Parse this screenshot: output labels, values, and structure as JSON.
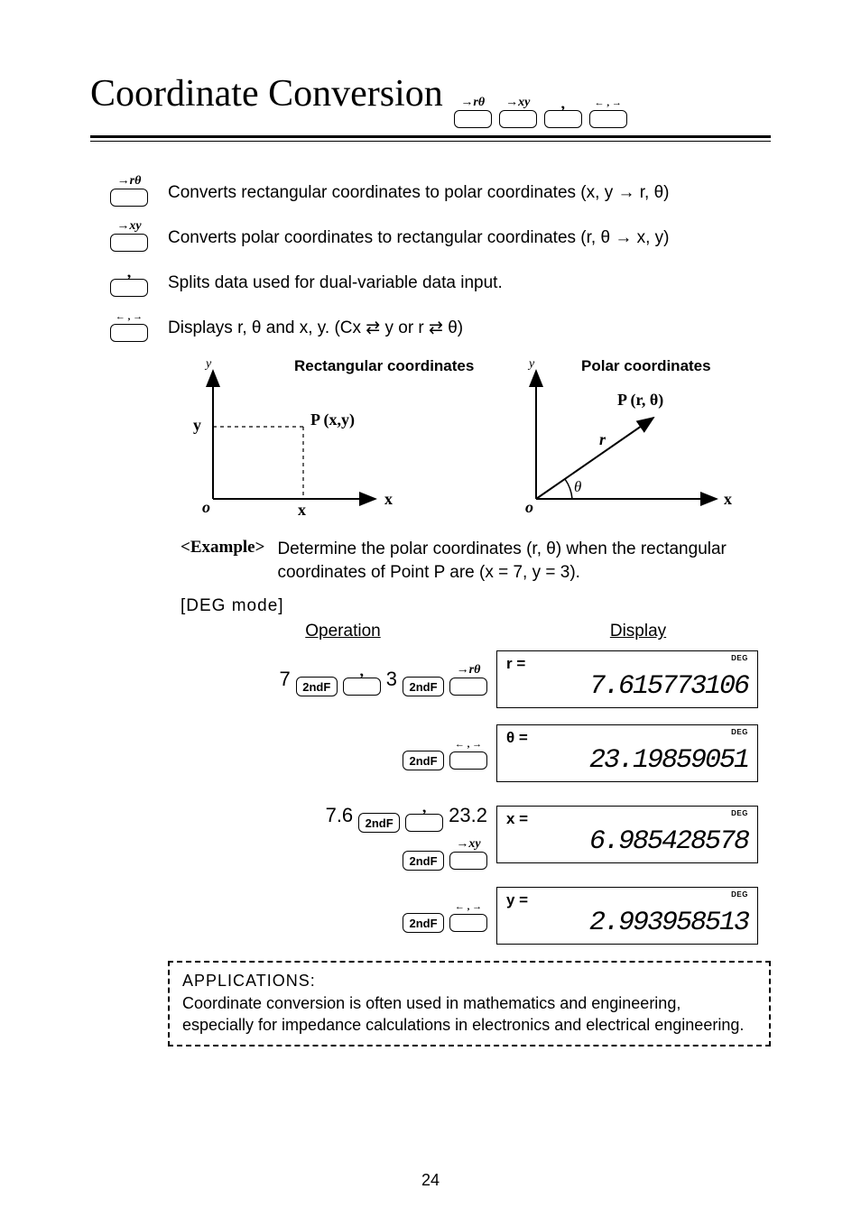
{
  "title": "Coordinate Conversion",
  "titleKeys": [
    "→rθ",
    "→xy",
    ",",
    "← , →"
  ],
  "defs": [
    {
      "keyTop": "→rθ",
      "desc": "Converts rectangular coordinates to polar coordinates (x, y → r, θ)"
    },
    {
      "keyTop": "→xy",
      "desc": "Converts polar coordinates to rectangular coordinates (r, θ → x, y)"
    },
    {
      "keyTop": ",",
      "desc": "Splits data used for dual-variable data input."
    },
    {
      "keyTop": "← , →",
      "desc": "Displays r, θ and x, y. (Cx ⇄ y or r ⇄ θ)"
    }
  ],
  "diagrams": {
    "rect": {
      "title": "Rectangular coordinates",
      "point": "P (x,y)",
      "o": "o",
      "x": "x",
      "y": "y",
      "X": "x",
      "Y": "y"
    },
    "polar": {
      "title": "Polar coordinates",
      "point": "P (r, θ)",
      "o": "o",
      "X": "x",
      "r": "r",
      "theta": "θ",
      "yAxis": "y"
    }
  },
  "example": {
    "tag": "<Example>",
    "text": "Determine the polar coordinates (r, θ) when the rectangular coordinates of Point P are (x = 7, y = 3).",
    "mode": "[DEG mode]",
    "headers": {
      "op": "Operation",
      "disp": "Display"
    }
  },
  "keys": {
    "secondF": "2ndF"
  },
  "steps": [
    {
      "opBefore": "7",
      "seq": [
        "2ndF",
        ",",
        "opMid:3",
        "2ndF",
        "→rθ"
      ],
      "lcdSym": "r =",
      "lcdVal": "7.615773106",
      "lcdMode": "DEG"
    },
    {
      "seq": [
        "2ndF",
        "← , →"
      ],
      "lcdSym": "θ =",
      "lcdVal": "23.19859051",
      "lcdMode": "DEG"
    },
    {
      "opBefore": "7.6",
      "line1": [
        "2ndF",
        ",",
        "opMid:23.2"
      ],
      "line2": [
        "2ndF",
        "→xy"
      ],
      "lcdSym": "x =",
      "lcdVal": "6.985428578",
      "lcdMode": "DEG"
    },
    {
      "seq": [
        "2ndF",
        "← , →"
      ],
      "lcdSym": "y =",
      "lcdVal": "2.993958513",
      "lcdMode": "DEG"
    }
  ],
  "applications": {
    "title": "APPLICATIONS:",
    "text": "Coordinate conversion is often used in mathematics and engineering, especially for impedance calculations in electronics and electrical engineering."
  },
  "pageNumber": "24"
}
